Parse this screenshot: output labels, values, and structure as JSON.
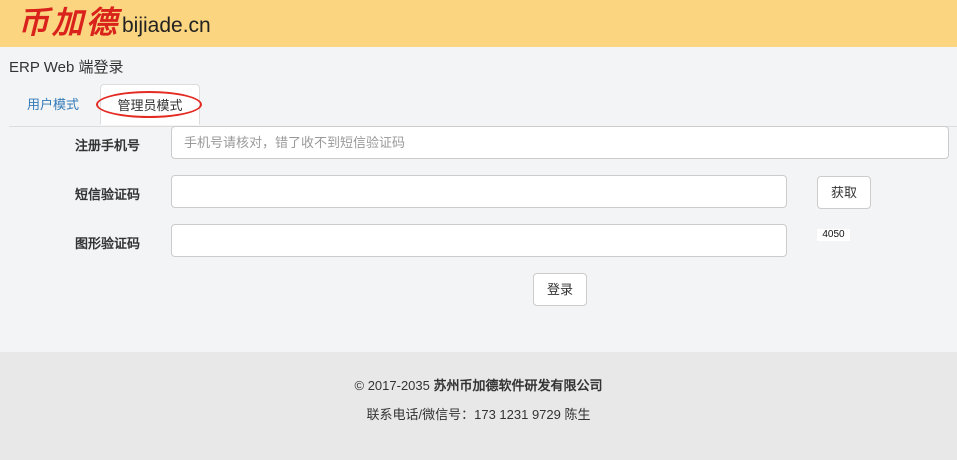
{
  "header": {
    "logo_cn": "币加德",
    "logo_en": "bijiade.cn"
  },
  "page_title": "ERP Web 端登录",
  "tabs": [
    {
      "label": "用户模式",
      "active": false
    },
    {
      "label": "管理员模式",
      "active": true
    }
  ],
  "form": {
    "phone_label": "注册手机号",
    "phone_placeholder": "手机号请核对，错了收不到短信验证码",
    "phone_value": "",
    "sms_label": "短信验证码",
    "sms_value": "",
    "get_code_label": "获取",
    "captcha_label": "图形验证码",
    "captcha_value": "",
    "captcha_image_text": "4050",
    "login_label": "登录"
  },
  "footer": {
    "copyright_prefix": "© 2017-2035 ",
    "company": "苏州币加德软件研发有限公司",
    "contact": "联系电话/微信号：173 1231 9729 陈生"
  },
  "colors": {
    "header_bg": "#fbd57f",
    "logo_red": "#d9221b",
    "tab_link": "#337ab7",
    "highlight_circle": "#e32b22"
  }
}
